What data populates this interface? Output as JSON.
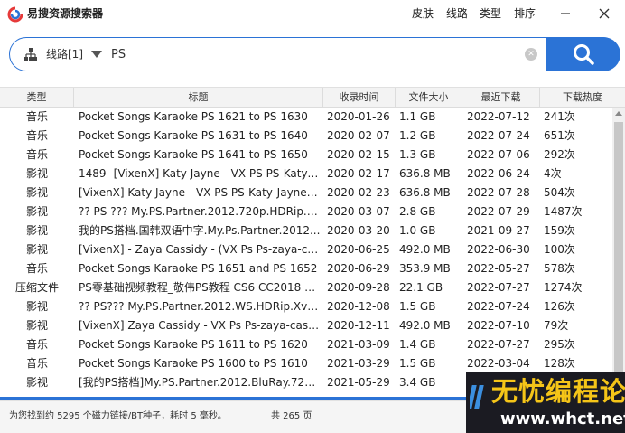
{
  "app": {
    "title": "易搜资源搜索器",
    "menu": [
      "皮肤",
      "线路",
      "类型",
      "排序"
    ]
  },
  "search": {
    "route_label": "线路[1]",
    "query": "PS"
  },
  "table": {
    "columns": [
      "类型",
      "标题",
      "收录时间",
      "文件大小",
      "最近下载",
      "下载热度"
    ],
    "rows": [
      [
        "音乐",
        "Pocket Songs Karaoke PS 1621 to PS 1630",
        "2020-01-26",
        "1.1 GB",
        "2022-07-12",
        "241次"
      ],
      [
        "音乐",
        "Pocket Songs Karaoke PS 1631 to PS 1640",
        "2020-02-07",
        "1.2 GB",
        "2022-07-24",
        "651次"
      ],
      [
        "音乐",
        "Pocket Songs Karaoke PS 1641 to PS 1650",
        "2020-02-15",
        "1.3 GB",
        "2022-07-06",
        "292次"
      ],
      [
        "影视",
        "1489- [VixenX] Katy Jayne - VX PS PS-Katy-J...",
        "2020-02-17",
        "636.8 MB",
        "2022-06-24",
        "4次"
      ],
      [
        "影视",
        "[VixenX] Katy Jayne - VX PS PS-Katy-Jayne (...",
        "2020-02-23",
        "636.8 MB",
        "2022-07-28",
        "504次"
      ],
      [
        "影视",
        "?? PS ??? My.PS.Partner.2012.720p.HDRip.H...",
        "2020-03-07",
        "2.8 GB",
        "2022-07-29",
        "1487次"
      ],
      [
        "影视",
        "我的PS搭档.国韩双语中字.My.Ps.Partner.2012...",
        "2020-03-20",
        "1.0 GB",
        "2021-09-27",
        "159次"
      ],
      [
        "影视",
        "[VixenX] - Zaya Cassidy - (VX Ps Ps-zaya-ca...",
        "2020-06-25",
        "492.0 MB",
        "2022-06-30",
        "100次"
      ],
      [
        "音乐",
        "Pocket Songs Karaoke PS 1651 and PS 1652",
        "2020-06-29",
        "353.9 MB",
        "2022-05-27",
        "578次"
      ],
      [
        "压缩文件",
        "PS零基础视频教程_敬伟PS教程 CS6 CC2018 p...",
        "2020-09-28",
        "22.1 GB",
        "2022-07-27",
        "1274次"
      ],
      [
        "影视",
        "?? PS??? My.PS.Partner.2012.WS.HDRip.XviD...",
        "2020-12-08",
        "1.5 GB",
        "2022-07-24",
        "126次"
      ],
      [
        "影视",
        "[VixenX] Zaya Cassidy - VX Ps Ps-zaya-cassi...",
        "2020-12-11",
        "492.0 MB",
        "2022-07-10",
        "79次"
      ],
      [
        "音乐",
        "Pocket Songs Karaoke PS 1611 to PS 1620",
        "2021-03-09",
        "1.4 GB",
        "2022-07-27",
        "295次"
      ],
      [
        "音乐",
        "Pocket Songs Karaoke PS 1600 to PS 1610",
        "2021-03-29",
        "1.5 GB",
        "2022-03-04",
        "128次"
      ],
      [
        "影视",
        "[我的PS搭档]My.PS.Partner.2012.BluRay.720...",
        "2021-05-29",
        "3.4 GB",
        "",
        ""
      ]
    ]
  },
  "status": {
    "text": "为您找到约 5295 个磁力链接/BT种子，耗时 5 毫秒。",
    "pages": "共 265 页"
  },
  "watermark": {
    "main": "无忧编程论坛",
    "url": "www.whct.net"
  },
  "colors": {
    "accent": "#2b73d6",
    "watermark_bg": "#1b1b22",
    "watermark_text": "#f5c518"
  },
  "icons": {
    "logo": "app-logo-icon",
    "route": "network-tree-icon",
    "search": "magnifier-icon",
    "clear": "clear-x-icon",
    "close": "close-x-icon"
  }
}
